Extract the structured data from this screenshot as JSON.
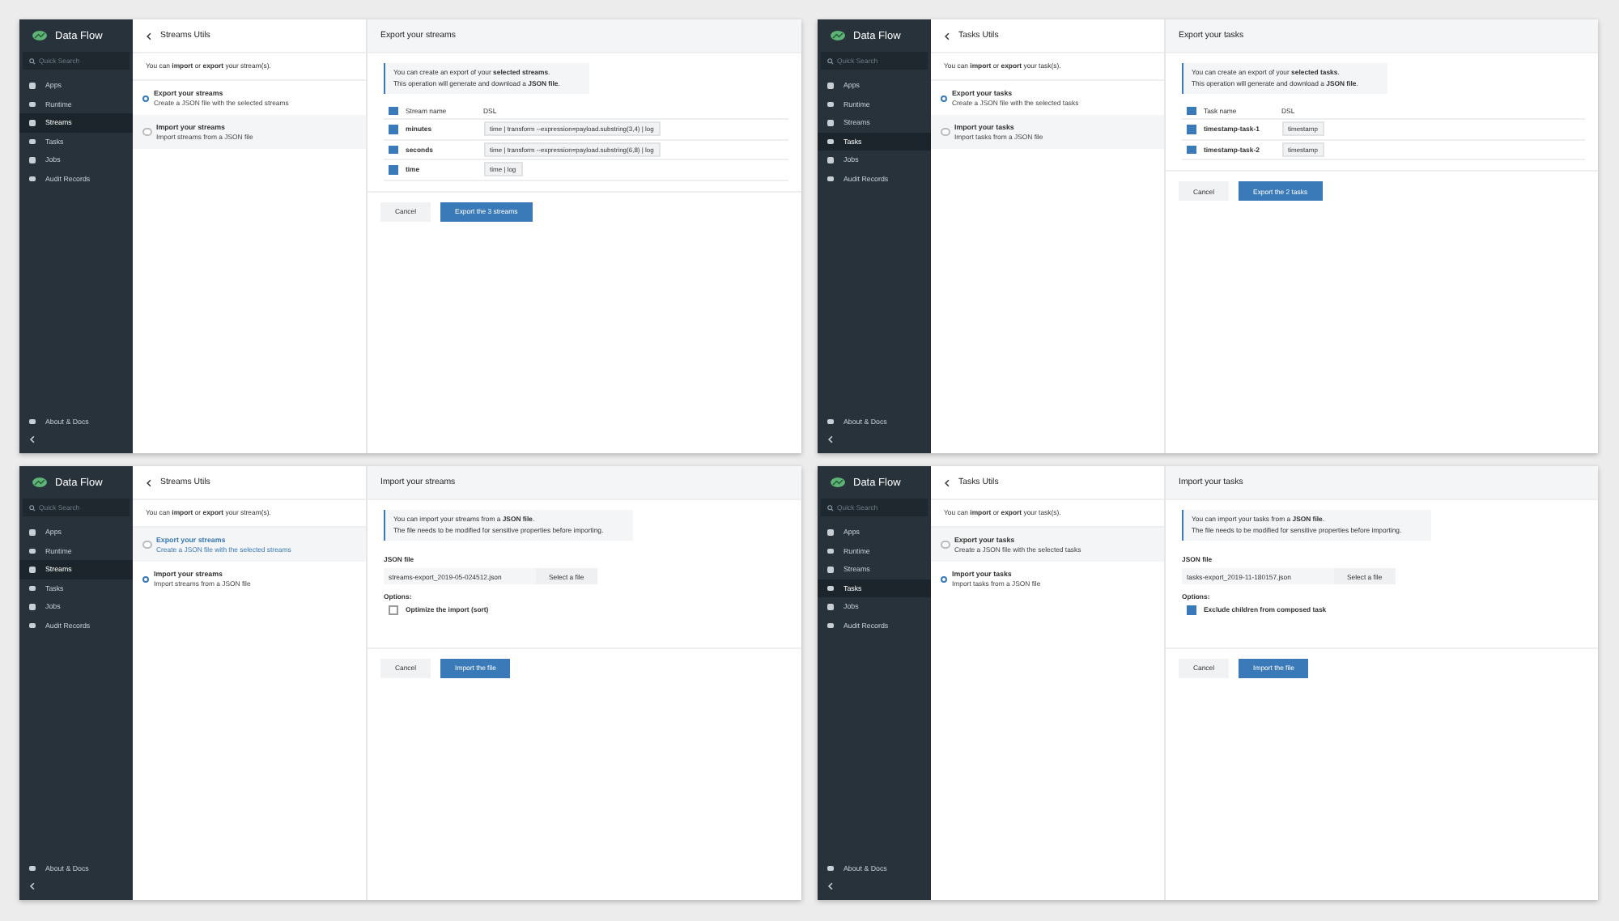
{
  "panels": [
    {
      "sidebar": {
        "brand": "Data Flow",
        "search": {
          "placeholder": "Quick Search"
        },
        "items": [
          {
            "label": "Apps",
            "selected": false
          },
          {
            "label": "Runtime",
            "selected": false
          },
          {
            "label": "Streams",
            "selected": true
          },
          {
            "label": "Tasks",
            "selected": false
          },
          {
            "label": "Jobs",
            "selected": false
          },
          {
            "label": "Audit Records",
            "selected": false
          }
        ],
        "footer": "About & Docs"
      },
      "utils_title": "Streams Utils",
      "intro": "You can **import** or **export** your stream(s).",
      "options": [
        {
          "title": "Export your streams",
          "description": "Create a JSON file with the selected streams",
          "selected": true,
          "hovered": false
        },
        {
          "title": "Import your streams",
          "description": "Import streams from a JSON file",
          "selected": false,
          "hovered": false
        }
      ],
      "content": {
        "kind": "export",
        "title": "Export your streams",
        "info": [
          "You can create an export of your **selected streams**.",
          "This operation will generate and download a **JSON file**."
        ],
        "columns": [
          "Stream name",
          "DSL"
        ],
        "header_checked": true,
        "rows": [
          {
            "name": "minutes",
            "dsl": "time | transform --expression=payload.substring(3,4) | log",
            "checked": true
          },
          {
            "name": "seconds",
            "dsl": "time | transform --expression=payload.substring(6,8) | log",
            "checked": true
          },
          {
            "name": "time",
            "dsl": "time | log",
            "checked": true
          }
        ],
        "cancel": "Cancel",
        "submit": "Export the 3 streams"
      }
    },
    {
      "sidebar": {
        "brand": "Data Flow",
        "search": {
          "placeholder": "Quick Search"
        },
        "items": [
          {
            "label": "Apps",
            "selected": false
          },
          {
            "label": "Runtime",
            "selected": false
          },
          {
            "label": "Streams",
            "selected": false
          },
          {
            "label": "Tasks",
            "selected": true
          },
          {
            "label": "Jobs",
            "selected": false
          },
          {
            "label": "Audit Records",
            "selected": false
          }
        ],
        "footer": "About & Docs"
      },
      "utils_title": "Tasks Utils",
      "intro": "You can **import** or **export** your task(s).",
      "options": [
        {
          "title": "Export your tasks",
          "description": "Create a JSON file with the selected tasks",
          "selected": true,
          "hovered": false
        },
        {
          "title": "Import your tasks",
          "description": "Import tasks from a JSON file",
          "selected": false,
          "hovered": false
        }
      ],
      "content": {
        "kind": "export",
        "title": "Export your tasks",
        "info": [
          "You can create an export of your **selected tasks**.",
          "This operation will generate and download a **JSON file**."
        ],
        "columns": [
          "Task name",
          "DSL"
        ],
        "header_checked": true,
        "rows": [
          {
            "name": "timestamp-task-1",
            "dsl": "timestamp",
            "checked": true
          },
          {
            "name": "timestamp-task-2",
            "dsl": "timestamp",
            "checked": true
          }
        ],
        "cancel": "Cancel",
        "submit": "Export the 2 tasks"
      }
    },
    {
      "sidebar": {
        "brand": "Data Flow",
        "search": {
          "placeholder": "Quick Search"
        },
        "items": [
          {
            "label": "Apps",
            "selected": false
          },
          {
            "label": "Runtime",
            "selected": false
          },
          {
            "label": "Streams",
            "selected": true
          },
          {
            "label": "Tasks",
            "selected": false
          },
          {
            "label": "Jobs",
            "selected": false
          },
          {
            "label": "Audit Records",
            "selected": false
          }
        ],
        "footer": "About & Docs"
      },
      "utils_title": "Streams Utils",
      "intro": "You can **import** or **export** your stream(s).",
      "options": [
        {
          "title": "Export your streams",
          "description": "Create a JSON file with the selected streams",
          "selected": false,
          "hovered": true
        },
        {
          "title": "Import your streams",
          "description": "Import streams from a JSON file",
          "selected": true,
          "hovered": false
        }
      ],
      "content": {
        "kind": "import",
        "title": "Import your streams",
        "info": [
          "You can import your streams from a **JSON file**.",
          "The file needs to be modified for sensitive properties before importing."
        ],
        "file_label": "JSON file",
        "file_value": "streams-export_2019-05-024512.json",
        "select_button": "Select a file",
        "options_label": "Options:",
        "option": {
          "label": "Optimize the import (sort)",
          "checked": false
        },
        "cancel": "Cancel",
        "submit": "Import the file"
      }
    },
    {
      "sidebar": {
        "brand": "Data Flow",
        "search": {
          "placeholder": "Quick Search"
        },
        "items": [
          {
            "label": "Apps",
            "selected": false
          },
          {
            "label": "Runtime",
            "selected": false
          },
          {
            "label": "Streams",
            "selected": false
          },
          {
            "label": "Tasks",
            "selected": true
          },
          {
            "label": "Jobs",
            "selected": false
          },
          {
            "label": "Audit Records",
            "selected": false
          }
        ],
        "footer": "About & Docs"
      },
      "utils_title": "Tasks Utils",
      "intro": "You can **import** or **export** your task(s).",
      "options": [
        {
          "title": "Export your tasks",
          "description": "Create a JSON file with the selected tasks",
          "selected": false,
          "hovered": false
        },
        {
          "title": "Import your tasks",
          "description": "Import tasks from a JSON file",
          "selected": true,
          "hovered": false
        }
      ],
      "content": {
        "kind": "import",
        "title": "Import your tasks",
        "info": [
          "You can import your tasks from a **JSON file**.",
          "The file needs to be modified for sensitive properties before importing."
        ],
        "file_label": "JSON file",
        "file_value": "tasks-export_2019-11-180157.json",
        "select_button": "Select a file",
        "options_label": "Options:",
        "option": {
          "label": "Exclude children from composed task",
          "checked": true
        },
        "cancel": "Cancel",
        "submit": "Import the file"
      }
    }
  ]
}
